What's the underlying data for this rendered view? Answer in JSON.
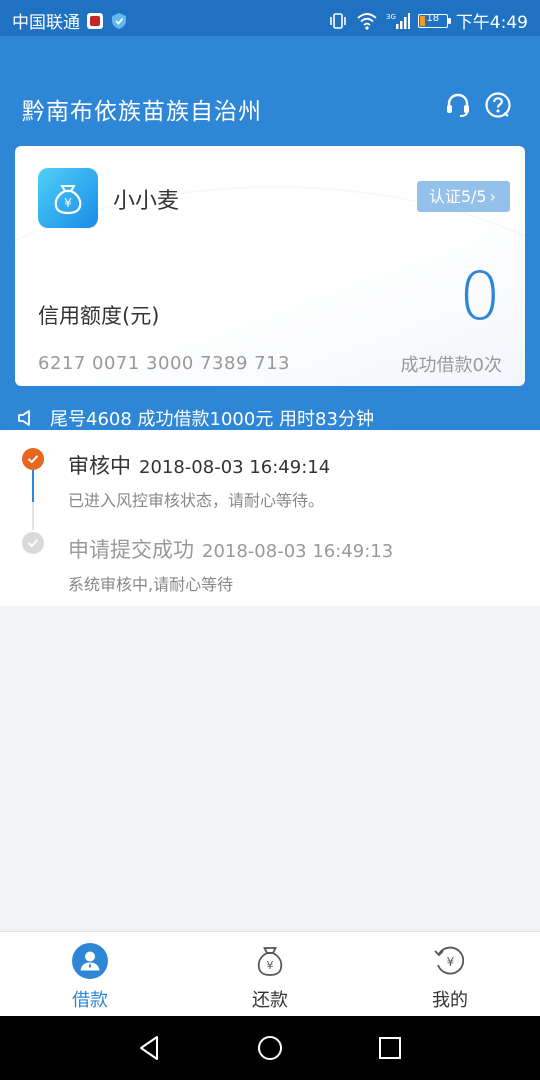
{
  "status_bar": {
    "carrier": "中国联通",
    "time": "下午4:49",
    "battery": "18",
    "network": "3G"
  },
  "header": {
    "title": "黔南布依族苗族自治州",
    "icons": [
      "headset-icon",
      "help-icon"
    ]
  },
  "card": {
    "app_name": "小小麦",
    "auth_badge": "认证5/5",
    "credit_label": "信用额度(元)",
    "credit_value": "0",
    "card_number": "6217 0071 3000 7389 713",
    "success_count": "成功借款0次"
  },
  "notice": {
    "text": "尾号4608 成功借款1000元 用时83分钟"
  },
  "timeline": [
    {
      "title": "审核中",
      "time": "2018-08-03 16:49:14",
      "desc": "已进入风控审核状态，请耐心等待。",
      "active": true
    },
    {
      "title": "申请提交成功",
      "time": "2018-08-03 16:49:13",
      "desc": "系统审核中,请耐心等待",
      "active": false
    }
  ],
  "bottom_nav": [
    {
      "label": "借款",
      "icon": "user-icon",
      "active": true
    },
    {
      "label": "还款",
      "icon": "money-bag-icon",
      "active": false
    },
    {
      "label": "我的",
      "icon": "history-icon",
      "active": false
    }
  ],
  "colors": {
    "primary": "#2e86d6",
    "status_bar": "#1f71c2",
    "active_orange": "#e8671e",
    "badge": "#94c1ea"
  }
}
